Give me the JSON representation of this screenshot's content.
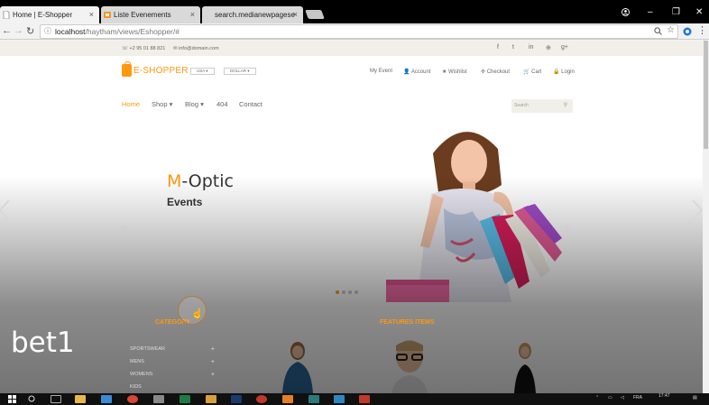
{
  "tabs": [
    {
      "label": "Home | E-Shopper",
      "close": "×"
    },
    {
      "label": "Liste Evenements",
      "close": "×"
    },
    {
      "label": "search.medianewpagese",
      "close": "×"
    }
  ],
  "window_controls": {
    "minimize": "–",
    "maximize": "❐",
    "close": "✕"
  },
  "address": {
    "host": "localhost",
    "path": "/haytham/views/Eshopper/#"
  },
  "site": {
    "phone": "+2 95 01 88 821",
    "email": "info@domain.com",
    "social": [
      "f",
      "t",
      "in",
      "⊕",
      "g+"
    ],
    "logo": "E-SHOPPER",
    "currency_country": "USA",
    "currency": "DOLLAR",
    "user_menu": [
      "My Event",
      "Account",
      "Wishlist",
      "Checkout",
      "Cart",
      "Login"
    ],
    "main_nav": [
      "Home",
      "Shop",
      "Blog",
      "404",
      "Contact"
    ],
    "search_placeholder": "Search"
  },
  "slider": {
    "title_m": "M",
    "title_rest": "-Optic",
    "subtitle": "Events"
  },
  "sections": {
    "category": "CATEGORY",
    "features": "FEATURES ITEMS"
  },
  "categories": [
    "SPORTSWEAR",
    "MENS",
    "WOMENS",
    "KIDS"
  ],
  "watermark": "bet1",
  "taskbar": {
    "lang": "FRA",
    "time": "17:47"
  },
  "colors": {
    "accent": "#fe980f",
    "tab_bar": "#000000"
  }
}
